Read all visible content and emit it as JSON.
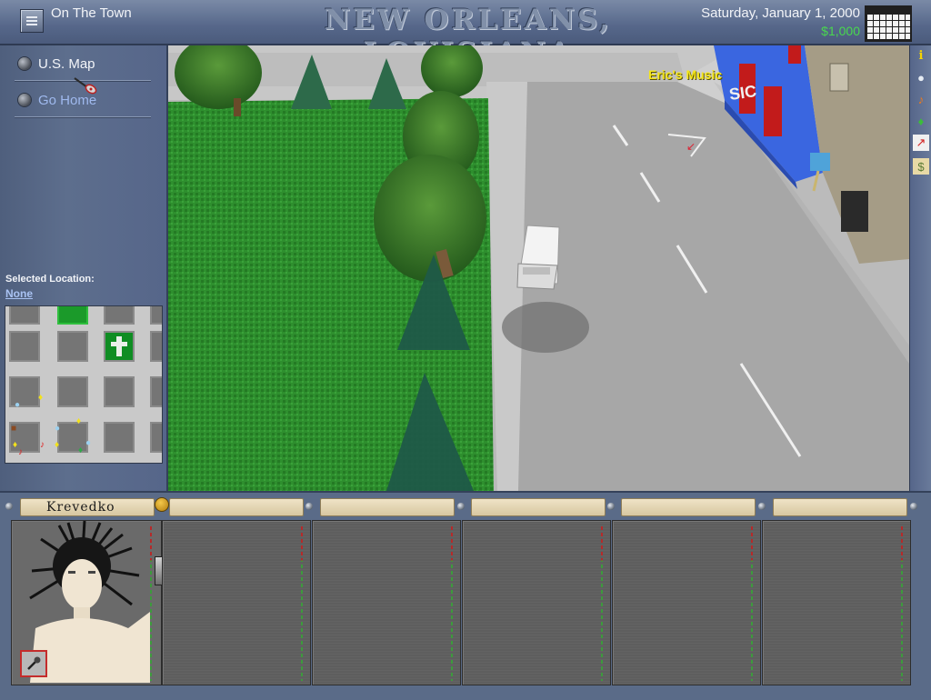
{
  "header": {
    "screen_title": "On The Town",
    "city": "NEW ORLEANS, LOUISIANA",
    "date": "Saturday, January 1, 2000",
    "money": "$1,000",
    "menu_icon": "menu-icon",
    "calendar_icon": "calendar-icon"
  },
  "nav": {
    "items": [
      {
        "label": "U.S. Map"
      },
      {
        "label": "Go Home"
      }
    ]
  },
  "selection": {
    "label": "Selected Location:",
    "value": "None"
  },
  "scene": {
    "store_label": "Eric's Music",
    "sign_text": "SIC"
  },
  "toolbar": {
    "items": [
      {
        "icon": "info-icon",
        "glyph": "i"
      },
      {
        "icon": "cd-icon",
        "glyph": "●"
      },
      {
        "icon": "music-note-icon",
        "glyph": "♪"
      },
      {
        "icon": "bottle-icon",
        "glyph": "♦"
      },
      {
        "icon": "chart-icon",
        "glyph": "↗"
      },
      {
        "icon": "money-icon",
        "glyph": "$"
      }
    ]
  },
  "band": {
    "members": [
      {
        "name": "Krevedko",
        "mood_icon": "smiley-icon"
      },
      {
        "name": ""
      },
      {
        "name": ""
      },
      {
        "name": ""
      },
      {
        "name": ""
      },
      {
        "name": ""
      }
    ],
    "mic_icon": "microphone-icon"
  },
  "colors": {
    "money": "#49d84e",
    "store_label": "#f5e61b",
    "link": "#9fb9ee"
  }
}
